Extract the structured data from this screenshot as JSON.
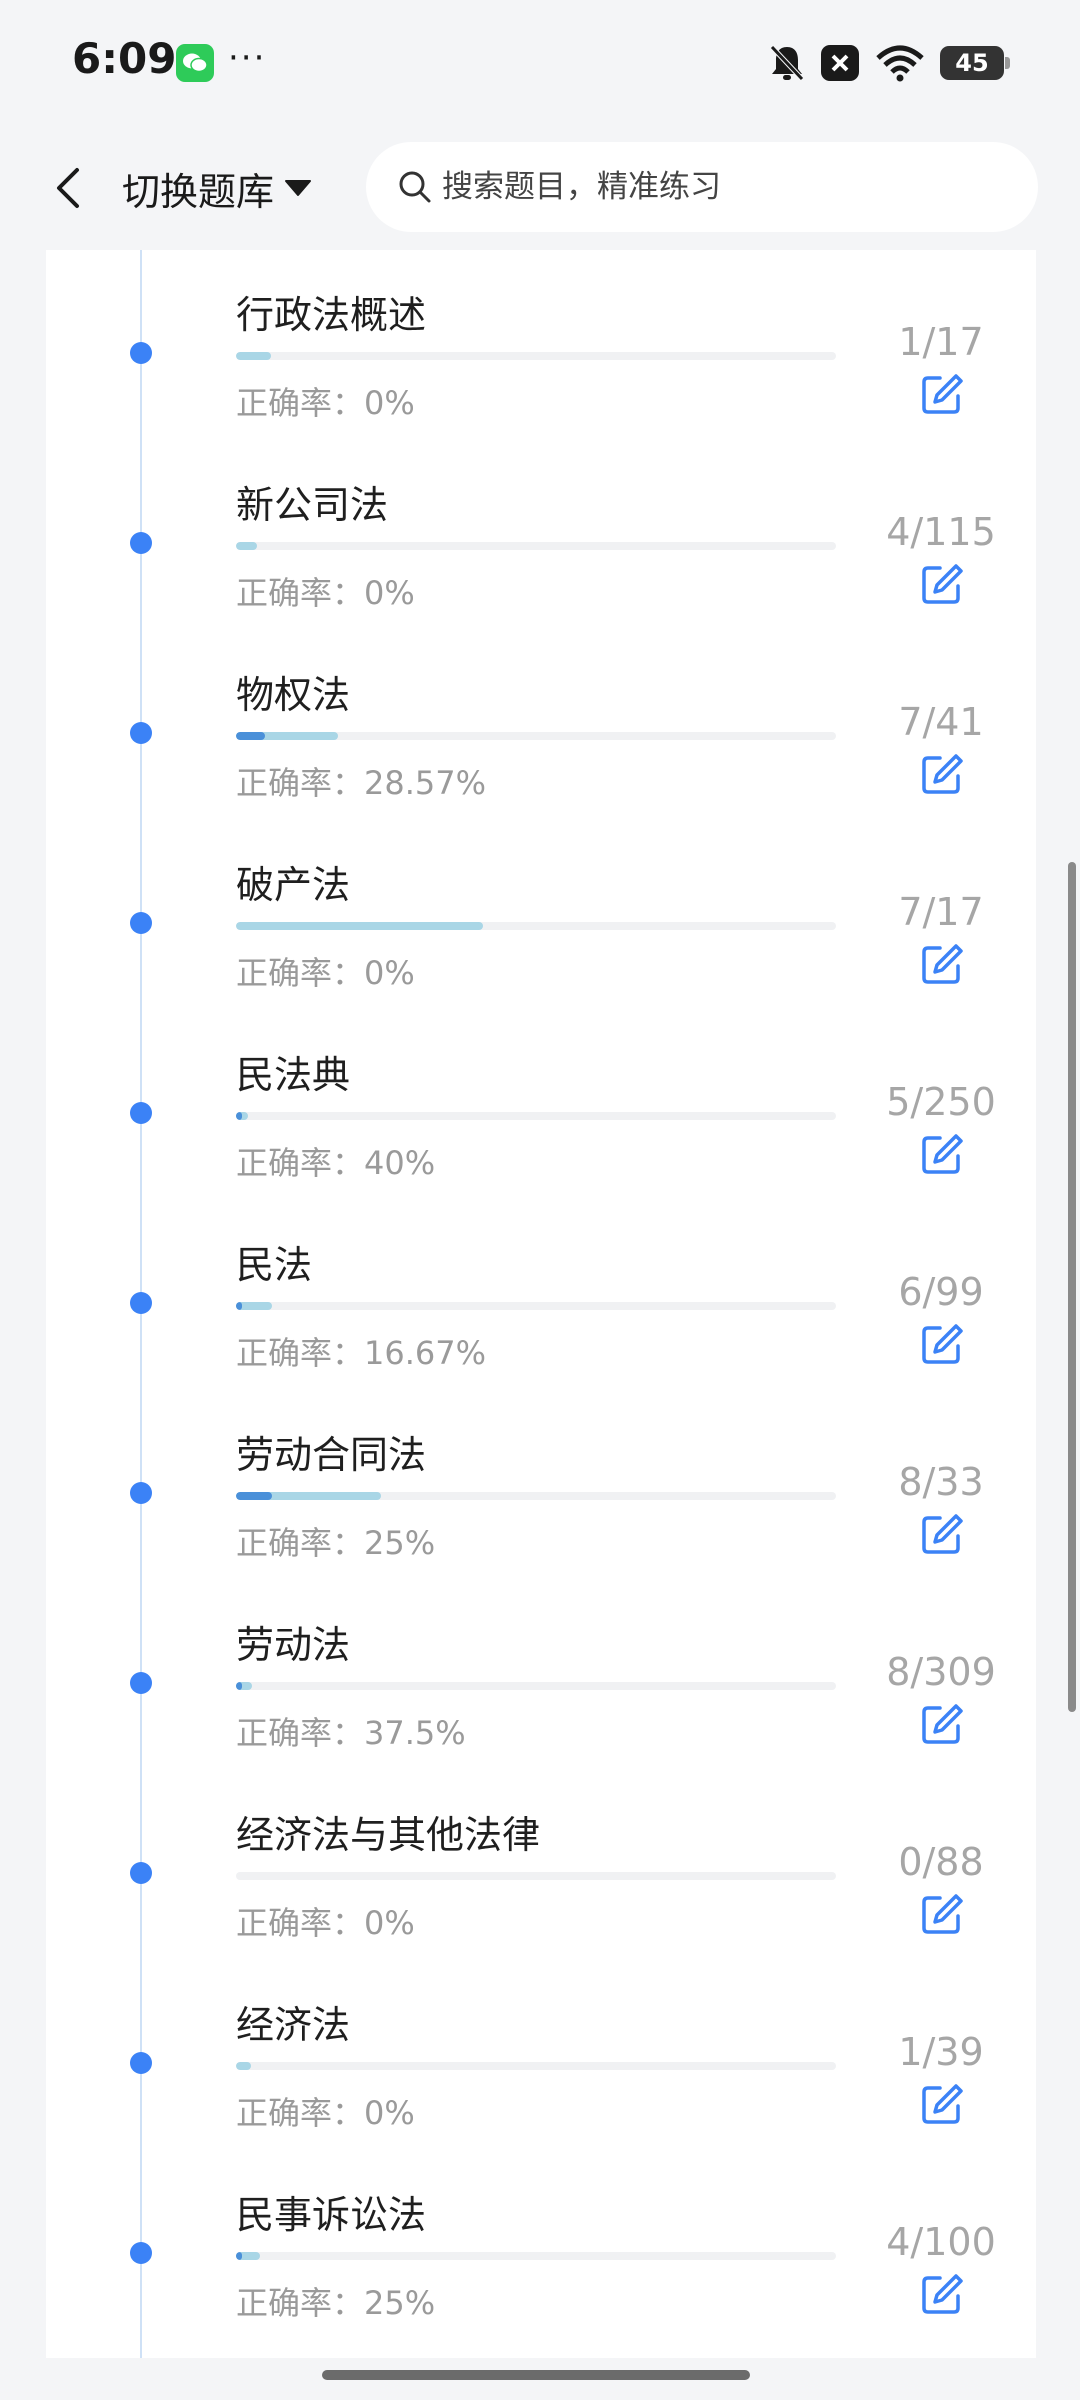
{
  "status_bar": {
    "time": "6:09",
    "more": "···",
    "battery": "45",
    "icons": [
      "wechat-icon",
      "bell-off-icon",
      "close-box-icon",
      "wifi-icon",
      "battery-icon"
    ]
  },
  "header": {
    "bank_switch_label": "切换题库",
    "search_placeholder": "搜索题目，精准练习"
  },
  "colors": {
    "accent": "#3b82f6",
    "progress_done": "#a9d6e6",
    "progress_correct": "#4a90d9",
    "muted_text": "#9a9a9a"
  },
  "items": [
    {
      "title": "行政法概述",
      "done": 1,
      "total": 17,
      "count": "1/17",
      "accuracy": "正确率：0%",
      "correct_rate": 0
    },
    {
      "title": "新公司法",
      "done": 4,
      "total": 115,
      "count": "4/115",
      "accuracy": "正确率：0%",
      "correct_rate": 0
    },
    {
      "title": "物权法",
      "done": 7,
      "total": 41,
      "count": "7/41",
      "accuracy": "正确率：28.57%",
      "correct_rate": 0.2857
    },
    {
      "title": "破产法",
      "done": 7,
      "total": 17,
      "count": "7/17",
      "accuracy": "正确率：0%",
      "correct_rate": 0
    },
    {
      "title": "民法典",
      "done": 5,
      "total": 250,
      "count": "5/250",
      "accuracy": "正确率：40%",
      "correct_rate": 0.4
    },
    {
      "title": "民法",
      "done": 6,
      "total": 99,
      "count": "6/99",
      "accuracy": "正确率：16.67%",
      "correct_rate": 0.1667
    },
    {
      "title": "劳动合同法",
      "done": 8,
      "total": 33,
      "count": "8/33",
      "accuracy": "正确率：25%",
      "correct_rate": 0.25
    },
    {
      "title": "劳动法",
      "done": 8,
      "total": 309,
      "count": "8/309",
      "accuracy": "正确率：37.5%",
      "correct_rate": 0.375
    },
    {
      "title": "经济法与其他法律",
      "done": 0,
      "total": 88,
      "count": "0/88",
      "accuracy": "正确率：0%",
      "correct_rate": 0
    },
    {
      "title": "经济法",
      "done": 1,
      "total": 39,
      "count": "1/39",
      "accuracy": "正确率：0%",
      "correct_rate": 0
    },
    {
      "title": "民事诉讼法",
      "done": 4,
      "total": 100,
      "count": "4/100",
      "accuracy": "正确率：25%",
      "correct_rate": 0.25
    }
  ]
}
